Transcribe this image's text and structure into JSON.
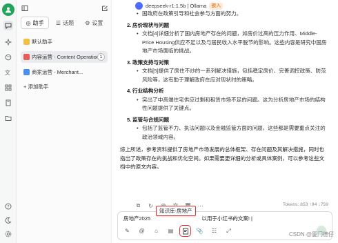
{
  "rail": {
    "icons": [
      "chat-icon",
      "sparkle-icon",
      "paint-icon",
      "translate-icon",
      "grid-icon",
      "book-icon",
      "folder-icon"
    ],
    "bottom_icons": [
      "help-icon",
      "theme-icon",
      "settings-icon"
    ]
  },
  "sidebar": {
    "tabs": [
      {
        "label": "助手",
        "icon": "robot-icon"
      },
      {
        "label": "话题",
        "icon": "list-icon"
      },
      {
        "label": "设置",
        "icon": "gear-icon"
      }
    ],
    "items": [
      {
        "label": "默认助手",
        "icon_color": "#f0c043"
      },
      {
        "label": "内容运营 - Content Operations",
        "icon_color": "#e85c57",
        "badge": "1"
      },
      {
        "label": "商家运营 - Merchant...",
        "icon_color": "#4a8fe7"
      }
    ],
    "add_label": "+ 添加助手"
  },
  "header": {
    "model": "deepseek-r1:1.5b | Ollama",
    "tag": "嵌入"
  },
  "content": {
    "intro_tail": "国政府在政策引导和社会参与方面的努力。",
    "sections": [
      {
        "num": "2.",
        "title": "房价现状与问题",
        "bullets": [
          "文档[4]详细分析了国内房地产存在的问题，如房价过高的压力作用、Middle-Price Housing供应不足以及与居民收入水平脱节的影响。这些内容是研究中国房地产市场面临的挑战。"
        ]
      },
      {
        "num": "3.",
        "title": "政策支持与对策",
        "bullets": [
          "文档[5]提供了房住不炒的一系列解决措施，包括稳定房价、完善调控政策、防范风险等，这有助于理解政府在应对现状时的策略。"
        ]
      },
      {
        "num": "4.",
        "title": "行业结构分析",
        "bullets": [
          "突出了中高端住宅供应过剩和租赁市场不足的问题。这为分析房地产市场的结构性问题提供了关键点。"
        ]
      },
      {
        "num": "5.",
        "title": "监管与合规问题",
        "bullets": [
          "包括了监管不力、执法问题以及金融监管方面的问题，这些都是需要重点关注的政治领域内容。"
        ]
      }
    ],
    "conclusion": "综上所述，参考资料提供了房地产市场发展的总体框架、存在问题及其解决措施，同时也指出了政策存在的挑战和优化空间。如果需要更详细的分析或具体案例，可以参考这些文档中的原文内容。"
  },
  "tokens": "Tokens: 853 ↑94 ↓759",
  "input": {
    "text_left": "房地产2025",
    "text_right": "以用于小红书的文案! |",
    "tooltip": "知识库-房地产"
  },
  "watermark": "CSDN @厦门德仔"
}
